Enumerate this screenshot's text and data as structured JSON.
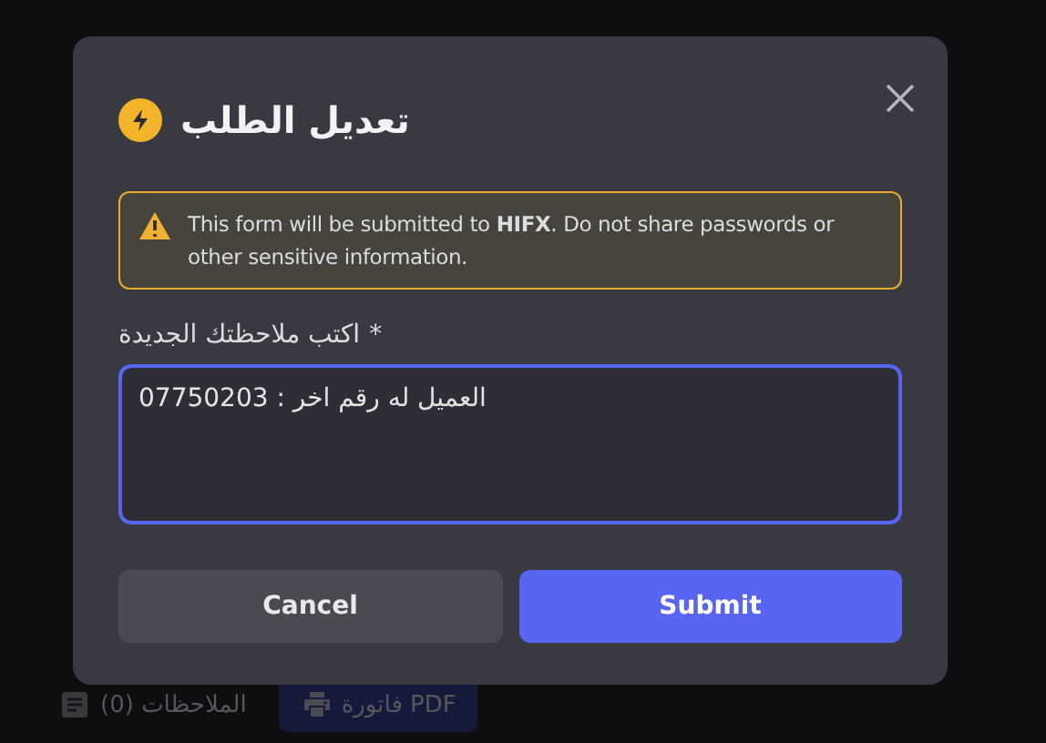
{
  "background_bar": {
    "buttons": [
      {
        "label": "فاتورة PDF",
        "kind": "pdf"
      },
      {
        "label": "الملاحظات (0)",
        "kind": "notes"
      }
    ]
  },
  "dialog": {
    "title": "تعديل الطلب",
    "warning": "This form will be submitted to **HIFX**. Do not share passwords or other sensitive information.",
    "field": {
      "label": "اكتب ملاحظتك الجديدة",
      "required_mark": "*",
      "value": "العميل له رقم اخر : 07750203"
    },
    "buttons": [
      {
        "label": "Submit",
        "kind": "primary"
      },
      {
        "label": "Cancel",
        "kind": "secondary"
      }
    ]
  }
}
